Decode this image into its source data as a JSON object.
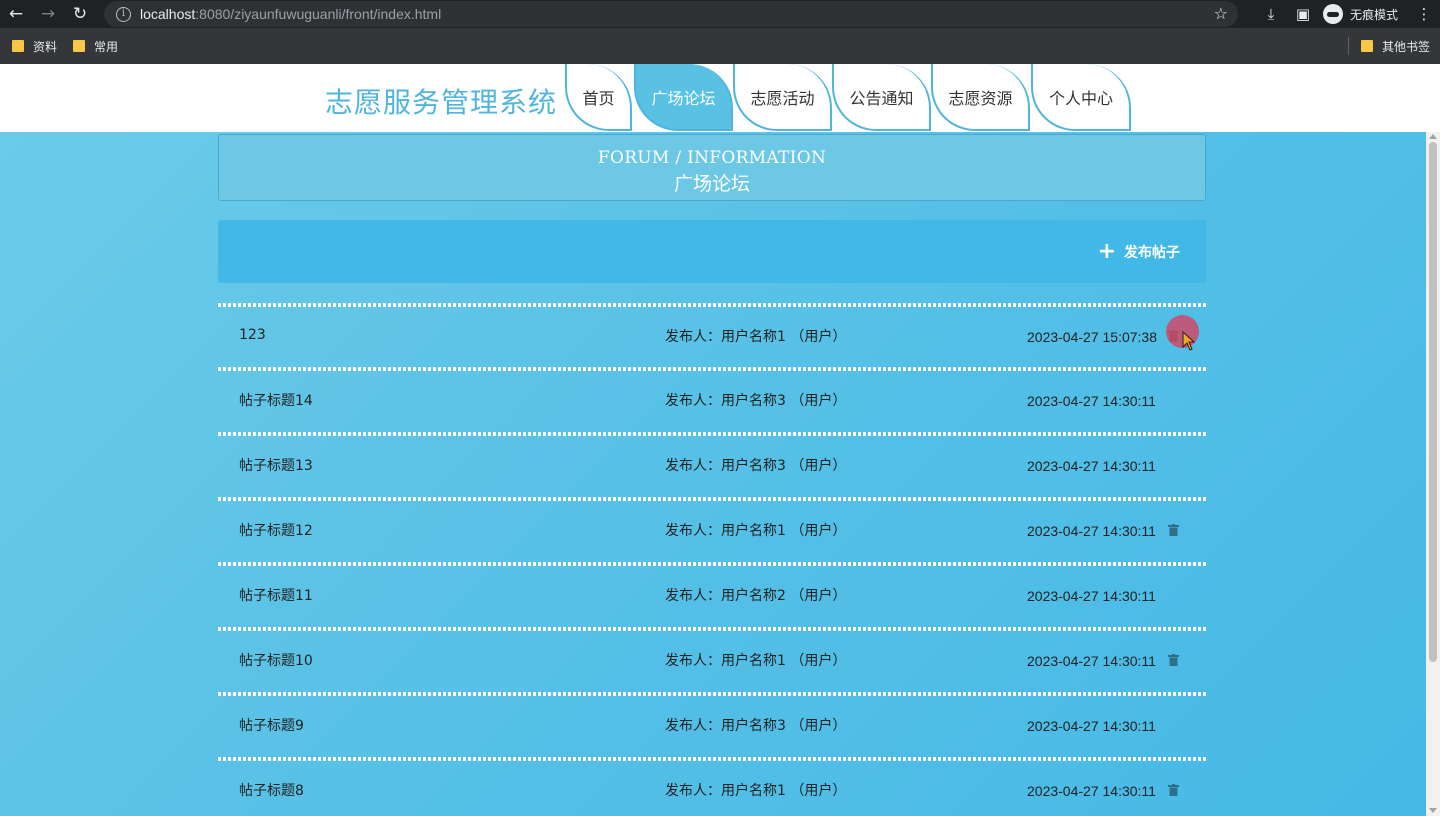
{
  "browser": {
    "url_host": "localhost",
    "url_rest": ":8080/ziyaunfuwuguanli/front/index.html",
    "incognito_label": "无痕模式",
    "bookmarks": [
      {
        "label": "资料"
      },
      {
        "label": "常用"
      }
    ],
    "other_bookmarks_label": "其他书签"
  },
  "header": {
    "brand": "志愿服务管理系统",
    "nav": [
      {
        "label": "首页",
        "active": false
      },
      {
        "label": "广场论坛",
        "active": true
      },
      {
        "label": "志愿活动",
        "active": false
      },
      {
        "label": "公告通知",
        "active": false
      },
      {
        "label": "志愿资源",
        "active": false
      },
      {
        "label": "个人中心",
        "active": false
      }
    ]
  },
  "page": {
    "title_en": "FORUM / INFORMATION",
    "title_cn": "广场论坛",
    "add_post_label": "发布帖子"
  },
  "posts": [
    {
      "title": "123",
      "author": "发布人：用户名称1 （用户）",
      "time": "2023-04-27 15:07:38",
      "deletable": true
    },
    {
      "title": "帖子标题14",
      "author": "发布人：用户名称3 （用户）",
      "time": "2023-04-27 14:30:11",
      "deletable": false
    },
    {
      "title": "帖子标题13",
      "author": "发布人：用户名称3 （用户）",
      "time": "2023-04-27 14:30:11",
      "deletable": false
    },
    {
      "title": "帖子标题12",
      "author": "发布人：用户名称1 （用户）",
      "time": "2023-04-27 14:30:11",
      "deletable": true
    },
    {
      "title": "帖子标题11",
      "author": "发布人：用户名称2 （用户）",
      "time": "2023-04-27 14:30:11",
      "deletable": false
    },
    {
      "title": "帖子标题10",
      "author": "发布人：用户名称1 （用户）",
      "time": "2023-04-27 14:30:11",
      "deletable": true
    },
    {
      "title": "帖子标题9",
      "author": "发布人：用户名称3 （用户）",
      "time": "2023-04-27 14:30:11",
      "deletable": false
    },
    {
      "title": "帖子标题8",
      "author": "发布人：用户名称1 （用户）",
      "time": "2023-04-27 14:30:11",
      "deletable": true
    }
  ],
  "colors": {
    "accent": "#4fb5dc",
    "content_bg": "#56c0e6",
    "action_bar": "#42b8e6",
    "active_tab": "#59c1e3"
  },
  "icons": {
    "delete": "trash-icon",
    "add": "plus-icon"
  }
}
